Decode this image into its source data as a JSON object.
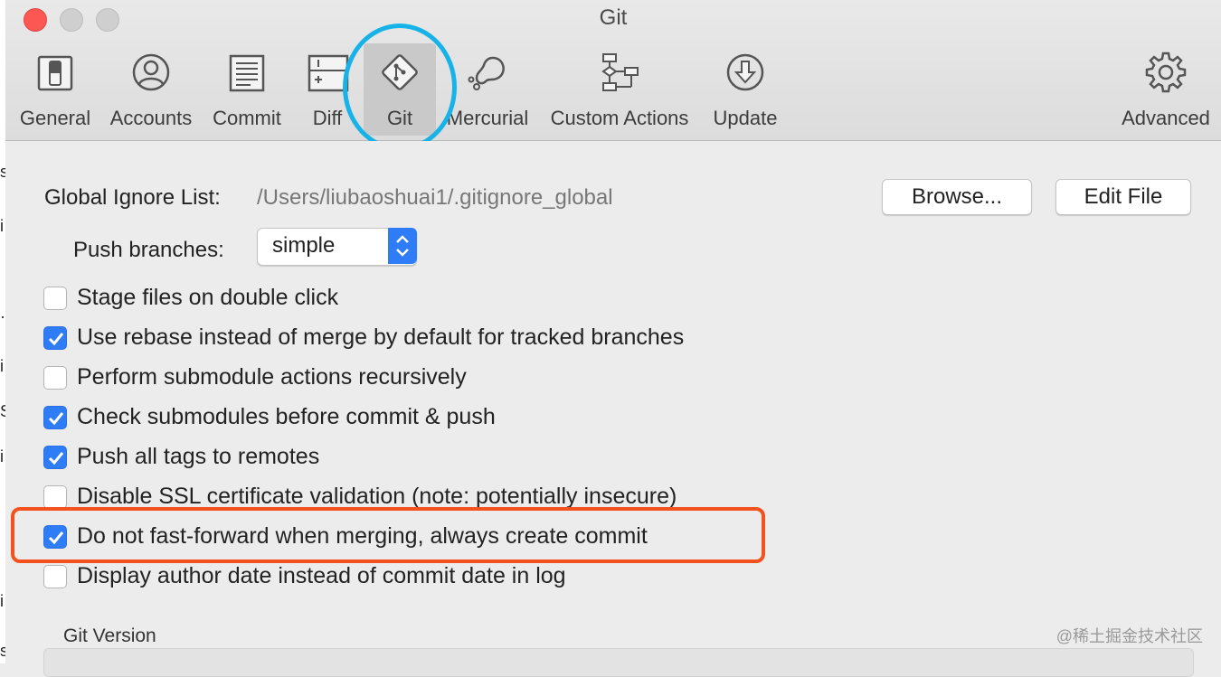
{
  "window": {
    "title": "Git"
  },
  "toolbar": {
    "items": [
      {
        "label": "General",
        "icon": "switch-icon"
      },
      {
        "label": "Accounts",
        "icon": "person-icon"
      },
      {
        "label": "Commit",
        "icon": "document-icon"
      },
      {
        "label": "Diff",
        "icon": "diff-icon"
      },
      {
        "label": "Git",
        "icon": "git-icon",
        "selected": true
      },
      {
        "label": "Mercurial",
        "icon": "mercurial-icon"
      },
      {
        "label": "Custom Actions",
        "icon": "flowchart-icon"
      },
      {
        "label": "Update",
        "icon": "download-arrow-icon"
      },
      {
        "label": "Advanced",
        "icon": "gear-icon"
      }
    ]
  },
  "git": {
    "global_ignore_label": "Global Ignore List:",
    "global_ignore_path": "/Users/liubaoshuai1/.gitignore_global",
    "browse_label": "Browse...",
    "edit_file_label": "Edit File",
    "push_branches_label": "Push branches:",
    "push_branches_value": "simple",
    "options": [
      {
        "label": "Stage files on double click",
        "checked": false
      },
      {
        "label": "Use rebase instead of merge by default for tracked branches",
        "checked": true
      },
      {
        "label": "Perform submodule actions recursively",
        "checked": false
      },
      {
        "label": "Check submodules before commit & push",
        "checked": true
      },
      {
        "label": "Push all tags to remotes",
        "checked": true
      },
      {
        "label": "Disable SSL certificate validation (note: potentially insecure)",
        "checked": false
      },
      {
        "label": "Do not fast-forward when merging, always create commit",
        "checked": true
      },
      {
        "label": "Display author date instead of commit date in log",
        "checked": false
      }
    ],
    "version_group_label": "Git Version"
  },
  "annotations": {
    "circle_color": "#17b3e8",
    "box_color": "#f3511e"
  },
  "watermark": "@稀土掘金技术社区",
  "accent_color": "#2f7df6"
}
